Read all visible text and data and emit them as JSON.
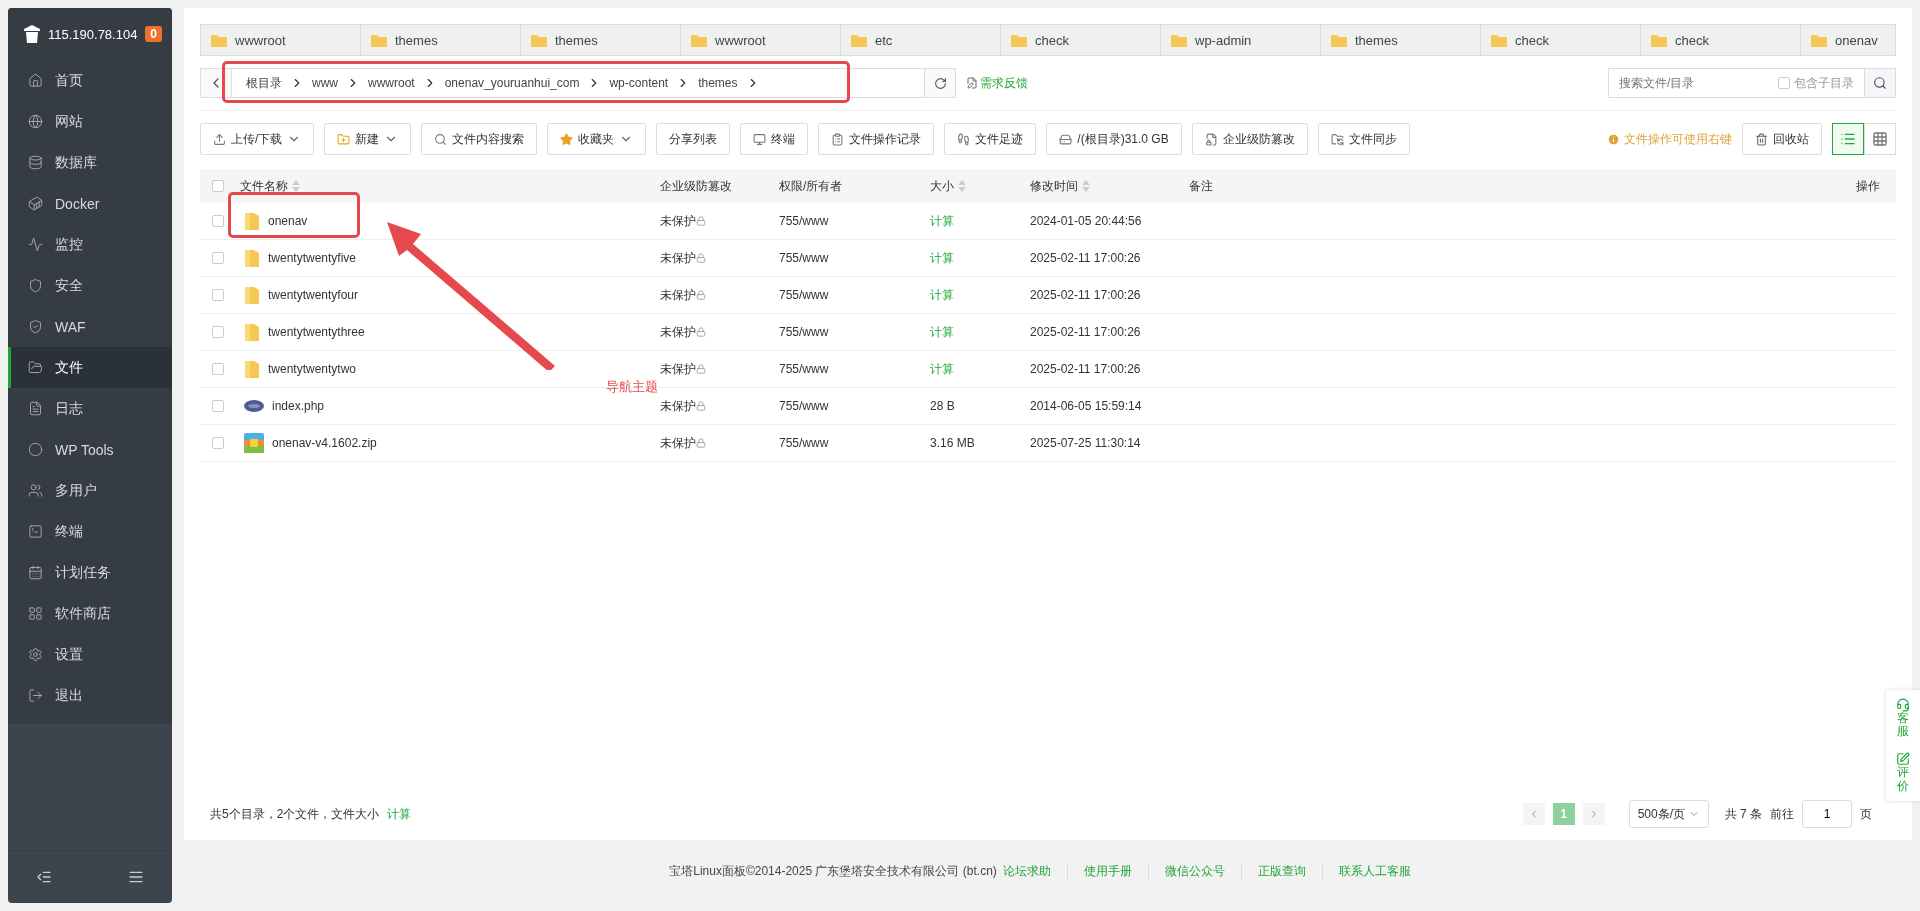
{
  "server": {
    "ip": "115.190.78.104",
    "badge": "0"
  },
  "sidebar": {
    "items": [
      {
        "label": "首页",
        "selected": false
      },
      {
        "label": "网站",
        "selected": false
      },
      {
        "label": "数据库",
        "selected": false
      },
      {
        "label": "Docker",
        "selected": false
      },
      {
        "label": "监控",
        "selected": false
      },
      {
        "label": "安全",
        "selected": false
      },
      {
        "label": "WAF",
        "selected": false
      },
      {
        "label": "文件",
        "selected": true
      },
      {
        "label": "日志",
        "selected": false
      },
      {
        "label": "WP Tools",
        "selected": false
      },
      {
        "label": "多用户",
        "selected": false
      },
      {
        "label": "终端",
        "selected": false
      },
      {
        "label": "计划任务",
        "selected": false
      },
      {
        "label": "软件商店",
        "selected": false
      },
      {
        "label": "设置",
        "selected": false
      },
      {
        "label": "退出",
        "selected": false
      }
    ]
  },
  "folder_tabs": [
    "wwwroot",
    "themes",
    "themes",
    "wwwroot",
    "etc",
    "check",
    "wp-admin",
    "themes",
    "check",
    "check",
    "onenav"
  ],
  "breadcrumb": [
    "根目录",
    "www",
    "wwwroot",
    "onenav_youruanhui_com",
    "wp-content",
    "themes"
  ],
  "feedback_link": "需求反馈",
  "search": {
    "placeholder": "搜索文件/目录",
    "include_sub_label": "包含子目录",
    "include_sub": false
  },
  "toolbar": [
    {
      "label": "上传/下载",
      "dropdown": true
    },
    {
      "label": "新建",
      "dropdown": true
    },
    {
      "label": "文件内容搜索",
      "dropdown": false
    },
    {
      "label": "收藏夹",
      "dropdown": true
    },
    {
      "label": "分享列表",
      "dropdown": false
    },
    {
      "label": "终端",
      "dropdown": false
    },
    {
      "label": "文件操作记录",
      "dropdown": false
    },
    {
      "label": "文件足迹",
      "dropdown": false
    },
    {
      "label": "/(根目录)31.0 GB",
      "dropdown": false
    },
    {
      "label": "企业级防篡改",
      "dropdown": false
    },
    {
      "label": "文件同步",
      "dropdown": false
    }
  ],
  "tip": "文件操作可使用右键",
  "recycle_button": "回收站",
  "view_modes": [
    {
      "kind": "list",
      "selected": true
    },
    {
      "kind": "grid",
      "selected": false
    }
  ],
  "table": {
    "all_checked": false,
    "columns": [
      {
        "label": "文件名称",
        "sortable": true
      },
      {
        "label": "企业级防篡改",
        "sortable": false
      },
      {
        "label": "权限/所有者",
        "sortable": false
      },
      {
        "label": "大小",
        "sortable": true
      },
      {
        "label": "修改时间",
        "sortable": true
      },
      {
        "label": "备注",
        "sortable": false
      },
      {
        "label": "操作",
        "sortable": false
      }
    ],
    "rows": [
      {
        "kind": "folder",
        "name": "onenav",
        "protect": "未保护",
        "perm": "755/www",
        "size": "计算",
        "size_link": true,
        "modified": "2024-01-05 20:44:56",
        "checked": false
      },
      {
        "kind": "folder",
        "name": "twentytwentyfive",
        "protect": "未保护",
        "perm": "755/www",
        "size": "计算",
        "size_link": true,
        "modified": "2025-02-11 17:00:26",
        "checked": false
      },
      {
        "kind": "folder",
        "name": "twentytwentyfour",
        "protect": "未保护",
        "perm": "755/www",
        "size": "计算",
        "size_link": true,
        "modified": "2025-02-11 17:00:26",
        "checked": false
      },
      {
        "kind": "folder",
        "name": "twentytwentythree",
        "protect": "未保护",
        "perm": "755/www",
        "size": "计算",
        "size_link": true,
        "modified": "2025-02-11 17:00:26",
        "checked": false
      },
      {
        "kind": "folder",
        "name": "twentytwentytwo",
        "protect": "未保护",
        "perm": "755/www",
        "size": "计算",
        "size_link": true,
        "modified": "2025-02-11 17:00:26",
        "checked": false
      },
      {
        "kind": "php",
        "name": "index.php",
        "protect": "未保护",
        "perm": "755/www",
        "size": "28 B",
        "size_link": false,
        "modified": "2014-06-05 15:59:14",
        "checked": false
      },
      {
        "kind": "zip",
        "name": "onenav-v4.1602.zip",
        "protect": "未保护",
        "perm": "755/www",
        "size": "3.16 MB",
        "size_link": false,
        "modified": "2025-07-25 11:30:14",
        "checked": false
      }
    ]
  },
  "summary": {
    "text": "共5个目录，2个文件，文件大小",
    "link": "计算"
  },
  "pagination": {
    "pages": [
      {
        "label": "1",
        "selected": true
      }
    ],
    "page_size": "500条/页",
    "total": "共 7 条",
    "goto_label": "前往",
    "goto_value": "1",
    "page_suffix": "页"
  },
  "side_widget": [
    {
      "label": "客服"
    },
    {
      "label": "评价"
    }
  ],
  "footer": {
    "copyright": "宝塔Linux面板©2014-2025 广东堡塔安全技术有限公司 (bt.cn)",
    "links": [
      "论坛求助",
      "使用手册",
      "微信公众号",
      "正版查询",
      "联系人工客服"
    ]
  },
  "annotation": {
    "text": "导航主题"
  }
}
